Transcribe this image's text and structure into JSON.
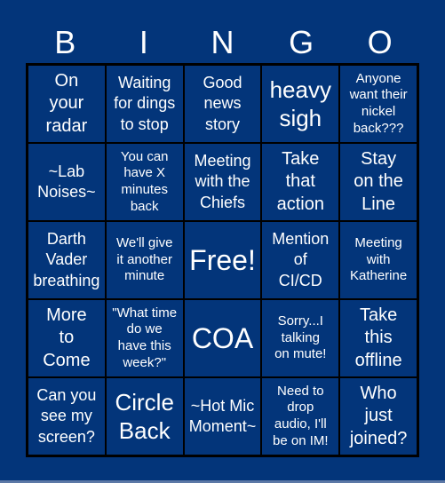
{
  "card": {
    "header": [
      "B",
      "I",
      "N",
      "G",
      "O"
    ],
    "colors": {
      "background": "#03357a",
      "cell": "#03357a",
      "border": "#000000",
      "text": "#ffffff"
    },
    "rows": [
      [
        {
          "text": "On\nyour\nradar",
          "size": "med2"
        },
        {
          "text": "Waiting\nfor dings\nto stop",
          "size": "med"
        },
        {
          "text": "Good\nnews\nstory",
          "size": "med"
        },
        {
          "text": "heavy\nsigh",
          "size": "large"
        },
        {
          "text": "Anyone\nwant their\nnickel\nback???",
          "size": "small"
        }
      ],
      [
        {
          "text": "~Lab\nNoises~",
          "size": "med"
        },
        {
          "text": "You can\nhave X\nminutes\nback",
          "size": "small"
        },
        {
          "text": "Meeting\nwith the\nChiefs",
          "size": "med"
        },
        {
          "text": "Take\nthat\naction",
          "size": "med2"
        },
        {
          "text": "Stay\non the\nLine",
          "size": "med2"
        }
      ],
      [
        {
          "text": "Darth\nVader\nbreathing",
          "size": "med"
        },
        {
          "text": "We'll give\nit another\nminute",
          "size": "small"
        },
        {
          "text": "Free!",
          "size": "xl"
        },
        {
          "text": "Mention\nof\nCI/CD",
          "size": "med"
        },
        {
          "text": "Meeting\nwith\nKatherine",
          "size": "small"
        }
      ],
      [
        {
          "text": "More\nto\nCome",
          "size": "med2"
        },
        {
          "text": "\"What time\ndo we\nhave this\nweek?\"",
          "size": "small"
        },
        {
          "text": "COA",
          "size": "xl"
        },
        {
          "text": "Sorry...I\ntalking\non mute!",
          "size": "small"
        },
        {
          "text": "Take\nthis\noffline",
          "size": "med2"
        }
      ],
      [
        {
          "text": "Can you\nsee my\nscreen?",
          "size": "med"
        },
        {
          "text": "Circle\nBack",
          "size": "large"
        },
        {
          "text": "~Hot Mic\nMoment~",
          "size": "med"
        },
        {
          "text": "Need to\ndrop\naudio, I'll\nbe on IM!",
          "size": "small"
        },
        {
          "text": "Who\njust\njoined?",
          "size": "med2"
        }
      ]
    ]
  }
}
